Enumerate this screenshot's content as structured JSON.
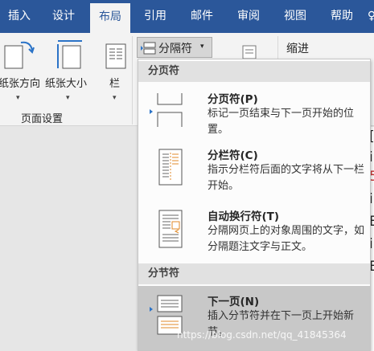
{
  "tabs": [
    {
      "label": "插入",
      "active": false
    },
    {
      "label": "设计",
      "active": false
    },
    {
      "label": "布局",
      "active": true
    },
    {
      "label": "引用",
      "active": false
    },
    {
      "label": "邮件",
      "active": false
    },
    {
      "label": "审阅",
      "active": false
    },
    {
      "label": "视图",
      "active": false
    },
    {
      "label": "帮助",
      "active": false
    }
  ],
  "ribbon": {
    "orientation_label": "纸张方向",
    "size_label": "纸张大小",
    "columns_label": "栏",
    "group_label": "页面设置",
    "breaks_label": "分隔符",
    "indent_label": "缩进"
  },
  "menu": {
    "section1_header": "分页符",
    "section2_header": "分节符",
    "items": [
      {
        "title": "分页符(P)",
        "desc": "标记一页结束与下一页开始的位置。",
        "icon": "page-break-icon"
      },
      {
        "title": "分栏符(C)",
        "desc": "指示分栏符后面的文字将从下一栏开始。",
        "icon": "column-break-icon"
      },
      {
        "title": "自动换行符(T)",
        "desc": "分隔网页上的对象周围的文字，如分隔题注文字与正文。",
        "icon": "text-wrapping-break-icon"
      },
      {
        "title": "下一页(N)",
        "desc": "插入分节符并在下一页上开始新节。",
        "icon": "next-page-section-break-icon",
        "highlighted": true
      }
    ]
  },
  "document_text": [
    "[",
    "i",
    "5",
    "i",
    "E",
    "i",
    "E"
  ],
  "watermark": "https://blog.csdn.net/qq_41845364",
  "colors": {
    "accent": "#2b579a",
    "menu_hover": "#c8c8c8",
    "header_bg": "#e1e1e1"
  }
}
